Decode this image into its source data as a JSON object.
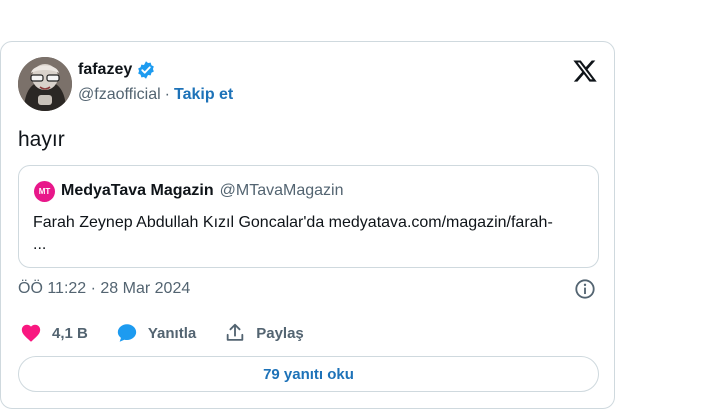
{
  "tweet": {
    "author": {
      "name": "fafazey",
      "handle": "@fzaofficial",
      "follow_label": "Takip et"
    },
    "text": "hayır",
    "quoted": {
      "avatar_text": "MT",
      "name": "MedyaTava Magazin",
      "handle": "@MTavaMagazin",
      "text": "Farah Zeynep Abdullah Kızıl Goncalar'da medyatava.com/magazin/farah-\n..."
    },
    "timestamp": "ÖÖ 11:22 · 28 Mar 2024",
    "actions": {
      "likes": "4,1 B",
      "reply_label": "Yanıtla",
      "share_label": "Paylaş"
    },
    "read_replies_label": "79 yanıtı oku"
  },
  "colors": {
    "accent": "#1d72b8",
    "like": "#f91880",
    "reply": "#1d9bf0",
    "verified": "#1d9bf0",
    "quoted_avatar": "#e8178a"
  },
  "icons": [
    "verified-badge-icon",
    "x-logo-icon",
    "info-icon",
    "heart-icon",
    "reply-bubble-icon",
    "share-icon"
  ]
}
